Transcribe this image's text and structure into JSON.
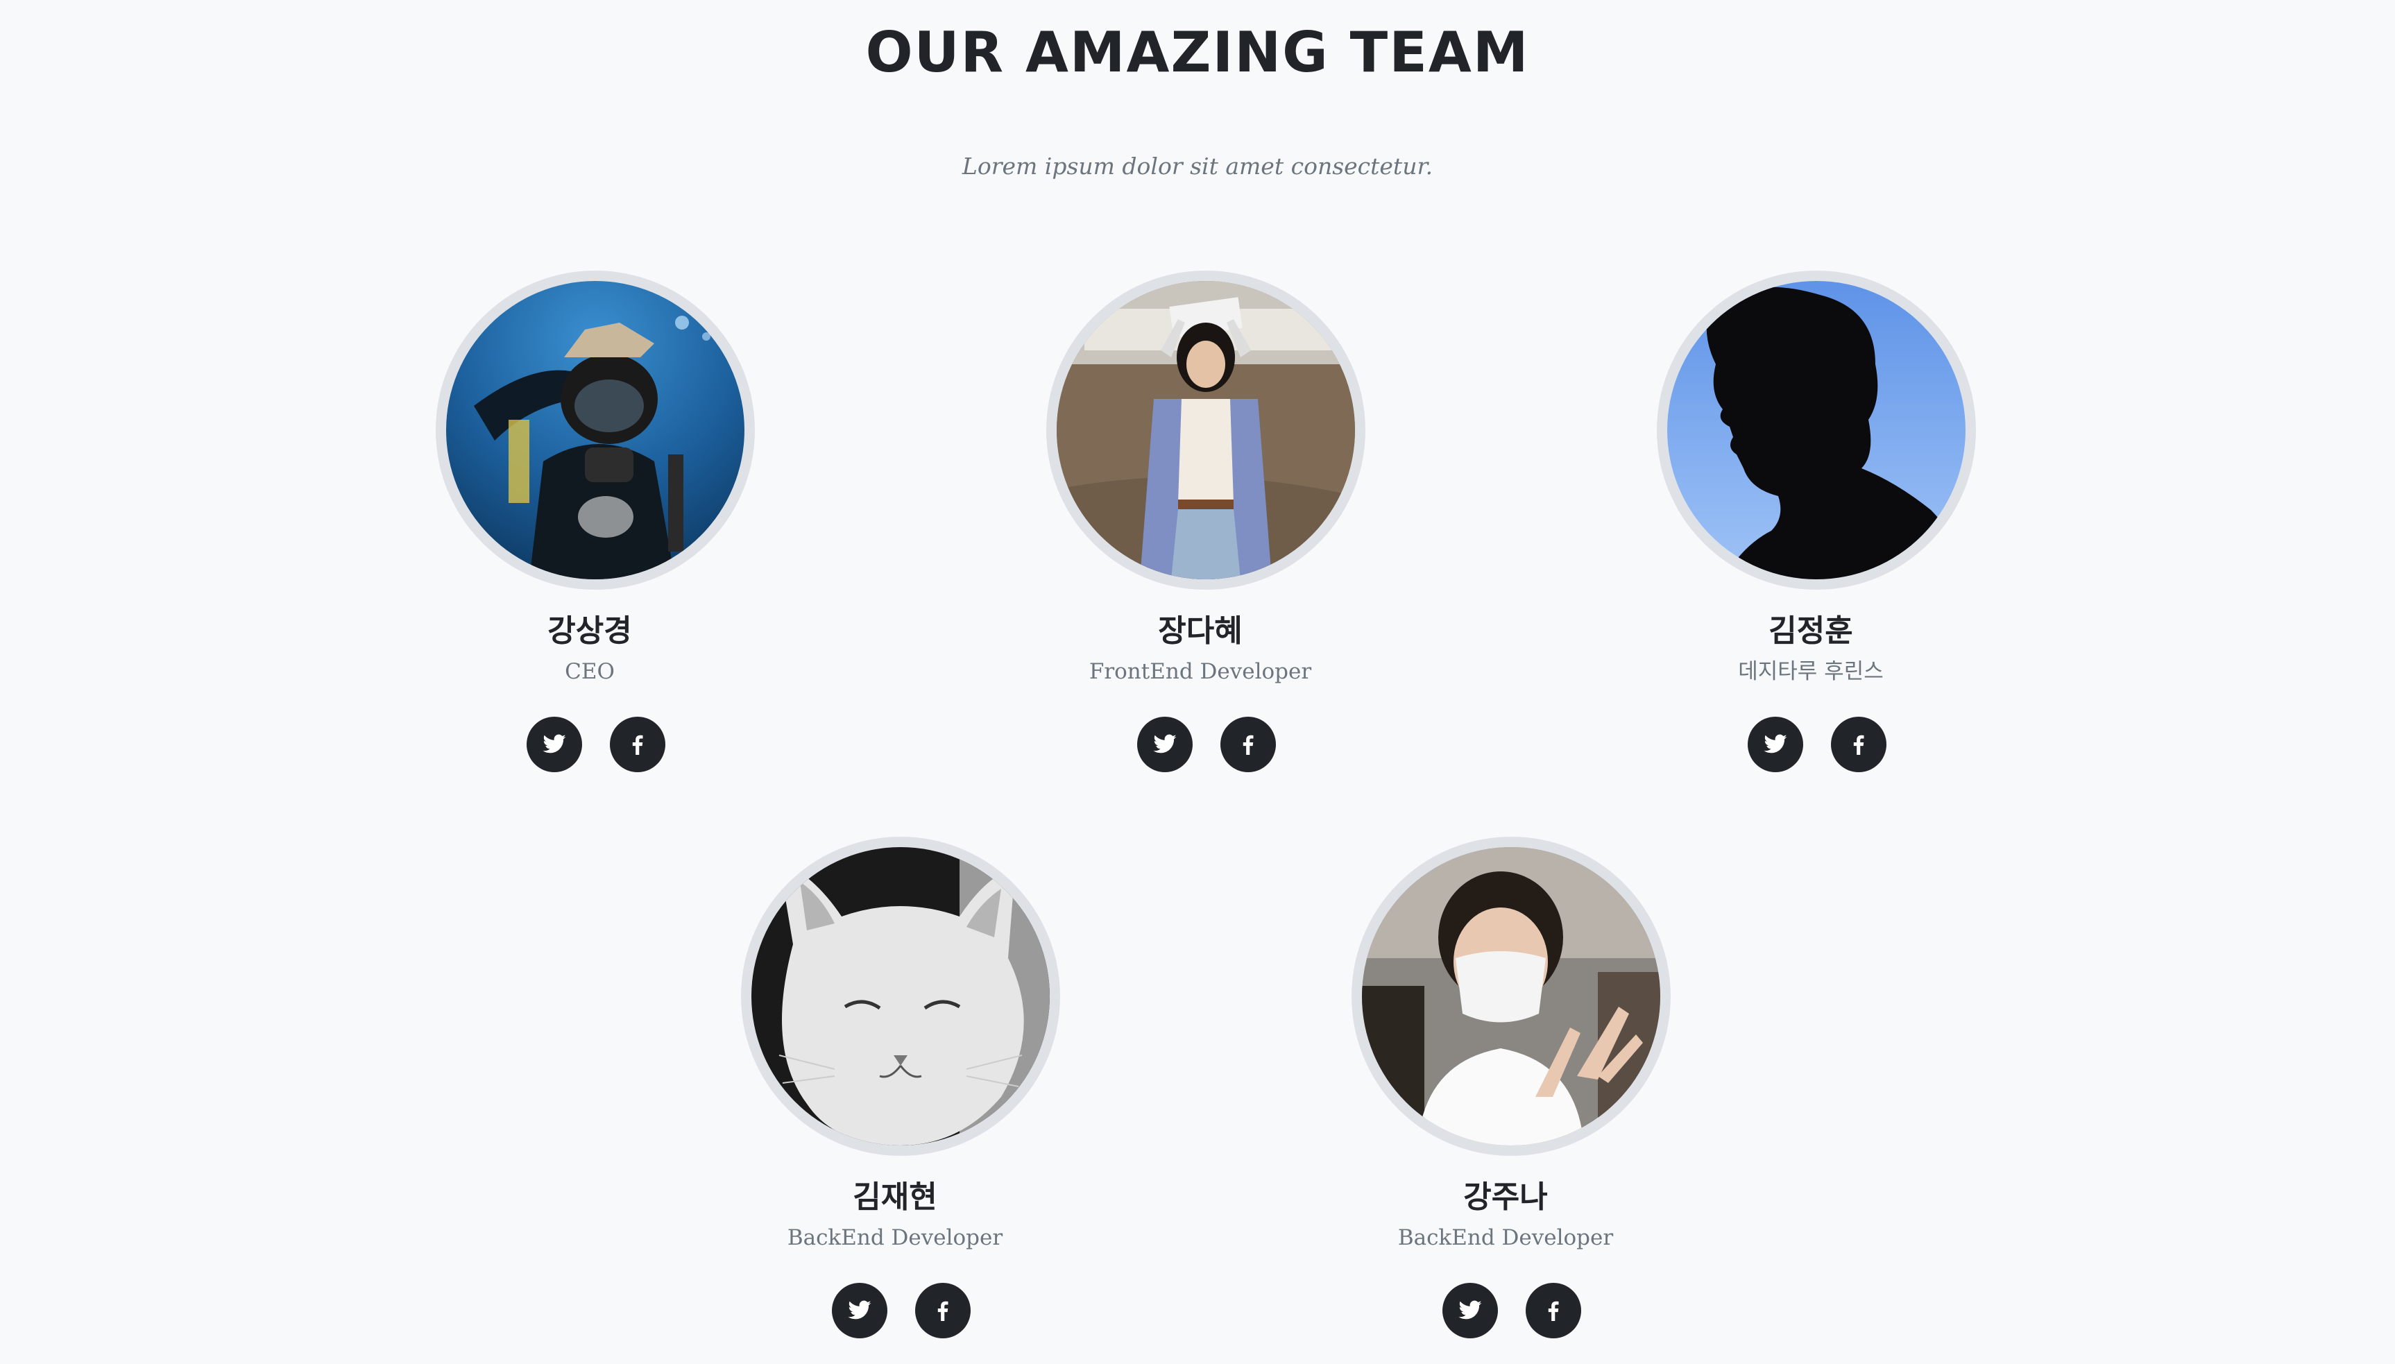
{
  "header": {
    "title": "OUR AMAZING TEAM",
    "subtitle": "Lorem ipsum dolor sit amet consectetur."
  },
  "team": [
    {
      "name": "강상경",
      "role": "CEO",
      "photo": "scuba-diver-underwater",
      "links": [
        "twitter-icon",
        "facebook-icon"
      ]
    },
    {
      "name": "장다혜",
      "role": "FrontEnd Developer",
      "photo": "woman-holding-paper-outdoors",
      "links": [
        "twitter-icon",
        "facebook-icon"
      ]
    },
    {
      "name": "김정훈",
      "role": "데지타루 후린스",
      "photo": "silhouette-profile-blue-sky",
      "links": [
        "twitter-icon",
        "facebook-icon"
      ]
    },
    {
      "name": "김재현",
      "role": "BackEnd Developer",
      "photo": "grayscale-white-cat",
      "links": [
        "twitter-icon",
        "facebook-icon"
      ]
    },
    {
      "name": "강주나",
      "role": "BackEnd Developer",
      "photo": "masked-person-peace-sign",
      "links": [
        "twitter-icon",
        "facebook-icon"
      ]
    }
  ],
  "colors": {
    "background": "#f8f9fa",
    "text": "#212529",
    "muted": "#6c757d",
    "avatar_border": "#dee2e6",
    "social_button": "#212529"
  }
}
